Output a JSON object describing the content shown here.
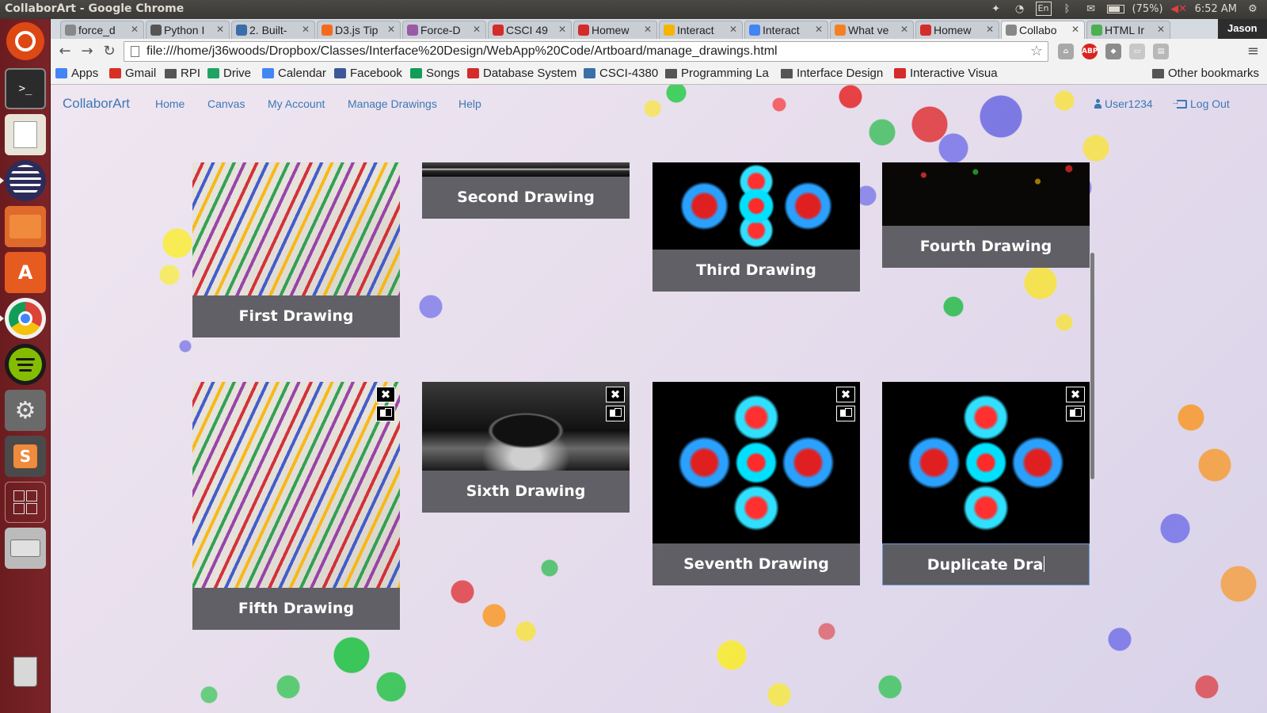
{
  "window": {
    "title": "CollaborArt - Google Chrome",
    "language": "En",
    "battery": "(75%)",
    "time": "6:52 AM",
    "user": "Jason"
  },
  "tabs": [
    {
      "label": "force_d",
      "favicon": "page",
      "color": "#888888"
    },
    {
      "label": "Python I",
      "favicon": "python-diamond",
      "color": "#555555"
    },
    {
      "label": "2. Built-",
      "favicon": "python",
      "color": "#3a6ea8"
    },
    {
      "label": "D3.js Tip",
      "favicon": "blogger",
      "color": "#f26b1d"
    },
    {
      "label": "Force-D",
      "favicon": "github",
      "color": "#9b5aa8"
    },
    {
      "label": "CSCI 49",
      "favicon": "cs",
      "color": "#d42b2b"
    },
    {
      "label": "Homew",
      "favicon": "cs",
      "color": "#d42b2b"
    },
    {
      "label": "Interact",
      "favicon": "slides",
      "color": "#f4b400"
    },
    {
      "label": "Interact",
      "favicon": "docs",
      "color": "#4285f4"
    },
    {
      "label": "What ve",
      "favicon": "stackoverflow",
      "color": "#f48024"
    },
    {
      "label": "Homew",
      "favicon": "cs",
      "color": "#d42b2b"
    },
    {
      "label": "Collabo",
      "favicon": "page",
      "color": "#888888",
      "active": true
    },
    {
      "label": "HTML Ir",
      "favicon": "w3schools",
      "color": "#4caf50"
    }
  ],
  "toolbar": {
    "url": "file:///home/j36woods/Dropbox/Classes/Interface%20Design/WebApp%20Code/Artboard/manage_drawings.html",
    "abp": "ABP"
  },
  "bookmarks": [
    {
      "label": "Apps",
      "icon": "apps-grid-icon",
      "color": "#4285f4"
    },
    {
      "label": "Gmail",
      "icon": "gmail-icon",
      "color": "#d93025"
    },
    {
      "label": "RPI",
      "icon": "folder-icon",
      "color": "#555555"
    },
    {
      "label": "Drive",
      "icon": "drive-icon",
      "color": "#1fa463"
    },
    {
      "label": "Calendar",
      "icon": "calendar-icon",
      "color": "#4285f4"
    },
    {
      "label": "Facebook",
      "icon": "facebook-icon",
      "color": "#3b5998"
    },
    {
      "label": "Songs",
      "icon": "sheets-icon",
      "color": "#0f9d58"
    },
    {
      "label": "Database System",
      "icon": "cs-icon",
      "color": "#d42b2b"
    },
    {
      "label": "CSCI-4380",
      "icon": "p-icon",
      "color": "#3a6ea8"
    },
    {
      "label": "Programming La",
      "icon": "folder-icon",
      "color": "#555555"
    },
    {
      "label": "Interface Design",
      "icon": "folder-icon",
      "color": "#555555"
    },
    {
      "label": "Interactive Visua",
      "icon": "cs-icon",
      "color": "#d42b2b"
    }
  ],
  "other_bookmarks": "Other bookmarks",
  "site": {
    "brand": "CollaborArt",
    "nav": [
      "Home",
      "Canvas",
      "My Account",
      "Manage Drawings",
      "Help"
    ],
    "user": "User1234",
    "logout": "Log Out"
  },
  "drawings": [
    {
      "title": "First Drawing",
      "image": "zebra",
      "actions": false
    },
    {
      "title": "Second Drawing",
      "image": "water",
      "actions": false
    },
    {
      "title": "Third Drawing",
      "image": "fractal",
      "actions": false
    },
    {
      "title": "Fourth Drawing",
      "image": "dark",
      "actions": false
    },
    {
      "title": "Fifth Drawing",
      "image": "zebra",
      "actions": true
    },
    {
      "title": "Sixth Drawing",
      "image": "apple",
      "actions": true
    },
    {
      "title": "Seventh Drawing",
      "image": "fractal",
      "actions": true
    },
    {
      "title": "Duplicate Dra",
      "image": "fractal",
      "actions": true,
      "editing": true
    }
  ],
  "colors": {
    "link": "#3d78b4",
    "launcher": "#7a2428",
    "title_bar": "#55555a"
  }
}
